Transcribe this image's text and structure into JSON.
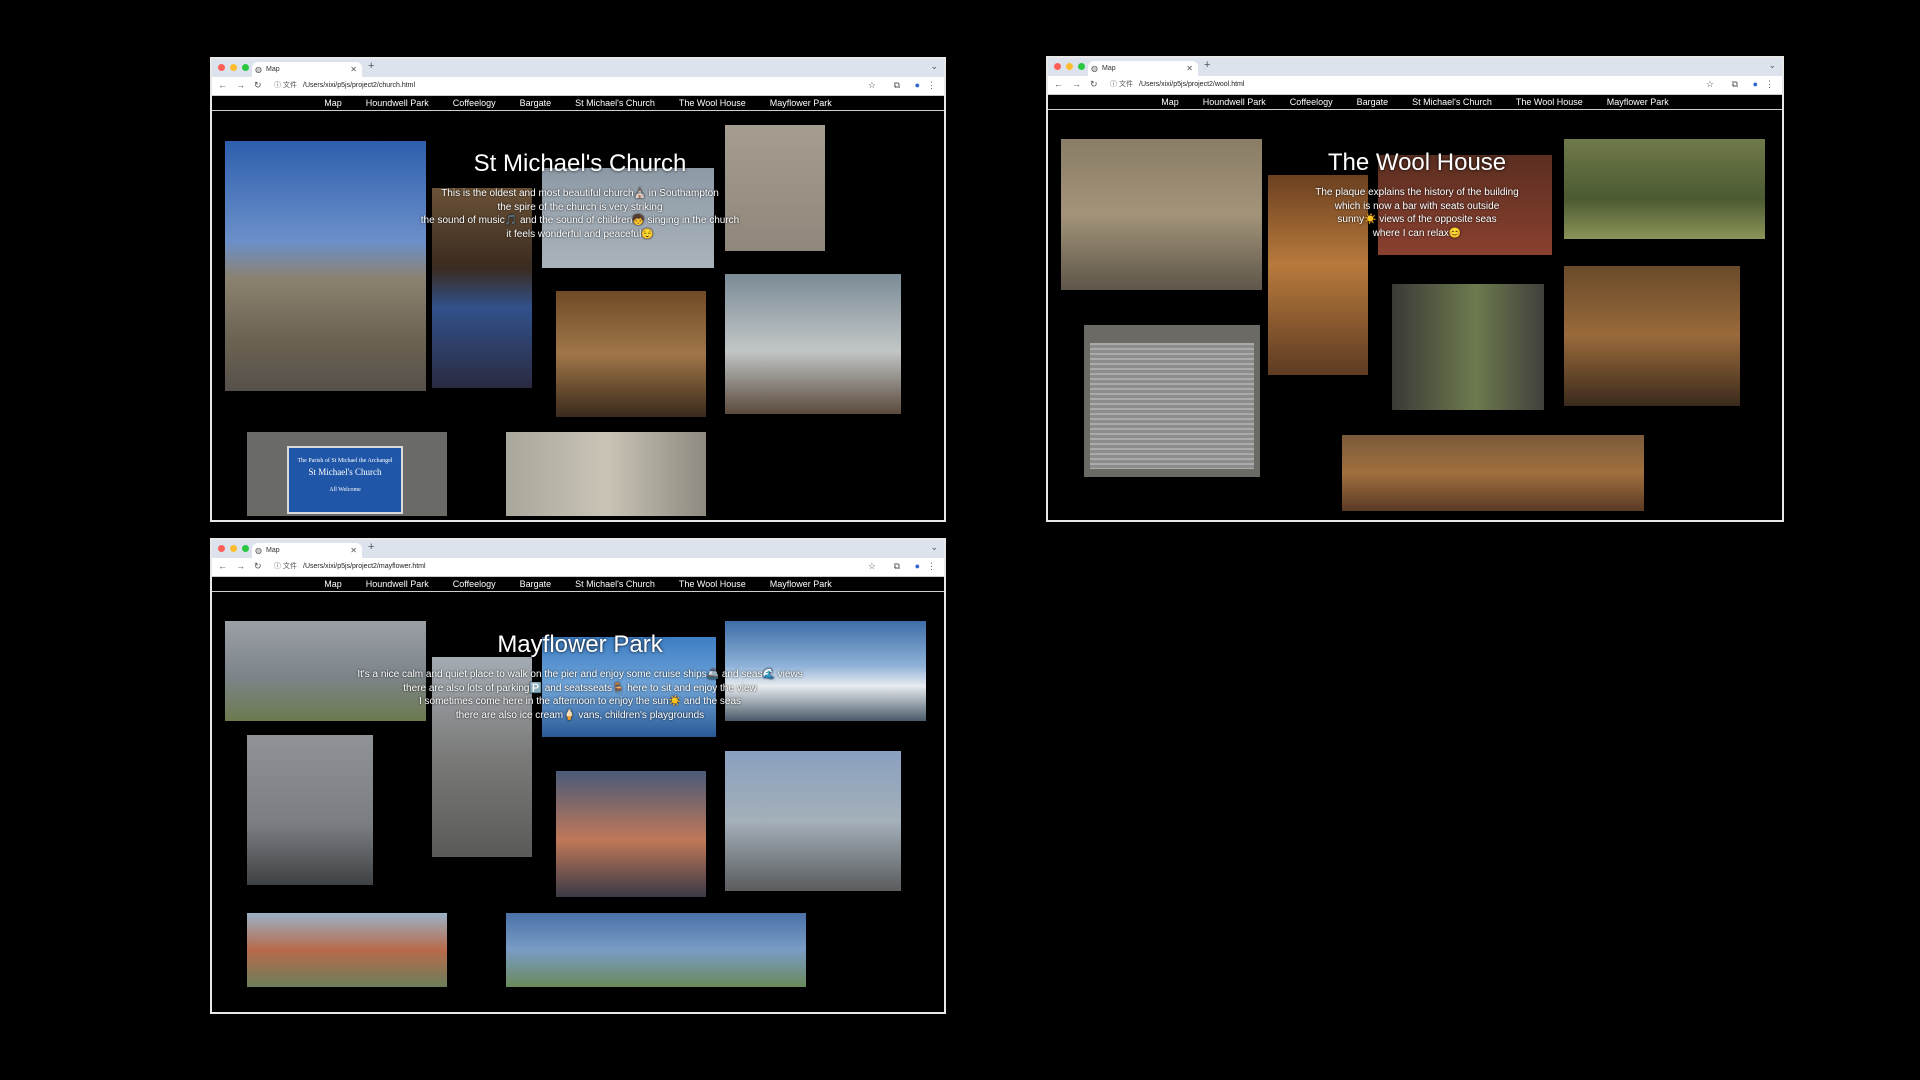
{
  "nav_items": [
    "Map",
    "Houndwell Park",
    "Coffeelogy",
    "Bargate",
    "St Michael's Church",
    "The Wool House",
    "Mayflower Park"
  ],
  "tab_title": "Map",
  "file_label": "文件",
  "church": {
    "url": "/Users/xixi/p5js/project2/church.html",
    "title": "St Michael's Church",
    "desc": [
      "This is the oldest and most beautiful church⛪ in Southampton",
      "the spire of the church is very striking",
      "the sound of music🎵 and the sound of children🧒 singing in the church",
      "it feels wonderful and peaceful😌"
    ],
    "sign": {
      "line1": "The Parish of St Michael the Archangel",
      "line2": "St Michael's Church",
      "line3": "All Welcome"
    }
  },
  "wool": {
    "url": "/Users/xixi/p5js/project2/wool.html",
    "title": "The Wool House",
    "desc": [
      "The plaque explains the history of the building",
      "which is now a bar with seats outside",
      "sunny☀️ views of the opposite seas",
      "where I can relax😊"
    ]
  },
  "mayflower": {
    "url": "/Users/xixi/p5js/project2/mayflower.html",
    "title": "Mayflower Park",
    "desc": [
      "It's a nice calm and quiet place to walk on the pier and enjoy some cruise ships🚢 and seas🌊 views",
      "there are also lots of parking🅿️ and seatsseats🪑 here to sit and enjoy the view",
      "I sometimes come here in the afternoon to enjoy the sun☀️ and the seas",
      "there are also ice cream🍦 vans, children's playgrounds"
    ]
  },
  "colors": {
    "background": "#000000",
    "window_border": "#e8e8e8",
    "tabbar": "#dde3ec",
    "close": "#ff5f57",
    "minimize": "#febc2e",
    "maximize": "#28c840"
  }
}
